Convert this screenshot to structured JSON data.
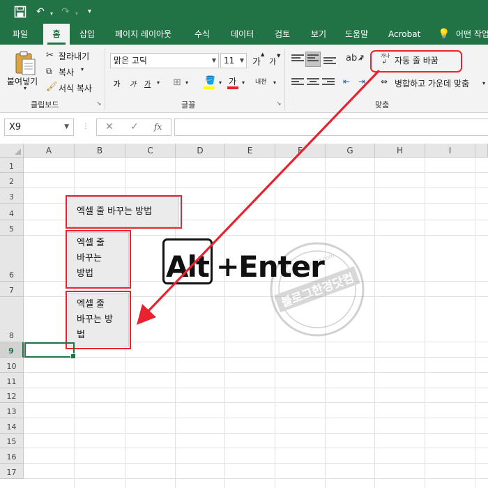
{
  "quick_access": {
    "save_icon": "save-icon",
    "undo_icon": "undo-icon",
    "redo_icon": "redo-icon"
  },
  "tabs": [
    {
      "label": "파일",
      "active": false
    },
    {
      "label": "홈",
      "active": true
    },
    {
      "label": "삽입",
      "active": false
    },
    {
      "label": "페이지 레이아웃",
      "active": false
    },
    {
      "label": "수식",
      "active": false
    },
    {
      "label": "데이터",
      "active": false
    },
    {
      "label": "검토",
      "active": false
    },
    {
      "label": "보기",
      "active": false
    },
    {
      "label": "도움말",
      "active": false
    },
    {
      "label": "Acrobat",
      "active": false
    },
    {
      "label": "어떤 작업",
      "active": false
    }
  ],
  "clipboard": {
    "paste": "붙여넣기",
    "cut": "잘라내기",
    "copy": "복사",
    "format_painter": "서식 복사",
    "group_label": "클립보드"
  },
  "font": {
    "name": "맑은 고딕",
    "size": "11",
    "increase": "가",
    "decrease": "가",
    "bold": "가",
    "italic": "가",
    "underline": "가",
    "font_color": "가",
    "phonetic": "내천",
    "group_label": "글꼴"
  },
  "alignment": {
    "wrap_text": "자동 줄 바꿈",
    "wrap_icon_text": "가나",
    "merge_center": "병합하고 가운데 맞춤",
    "group_label": "맞춤"
  },
  "formula_bar": {
    "name_box": "X9",
    "cancel": "✕",
    "enter": "✓",
    "fx": "fx",
    "formula": ""
  },
  "columns": [
    "A",
    "B",
    "C",
    "D",
    "E",
    "F",
    "G",
    "H",
    "I"
  ],
  "rows": [
    "1",
    "2",
    "3",
    "4",
    "5",
    "6",
    "7",
    "8",
    "9",
    "10",
    "11",
    "12",
    "13",
    "14",
    "15",
    "16",
    "17"
  ],
  "selected_row": "9",
  "cells": {
    "b4": "엑셀 줄 바꾸는 방법",
    "b6_line1": "엑셀 줄",
    "b6_line2": "바꾸는",
    "b6_line3": "방법",
    "b8_line1": "엑셀 줄",
    "b8_line2": "바꾸는 방",
    "b8_line3": "법"
  },
  "overlay": {
    "key": "Alt",
    "plus": "+",
    "enter": "Enter"
  },
  "watermark": {
    "main": "블로그한경닷컴",
    "url": "blog.hankyung.com"
  },
  "colors": {
    "excel_green": "#217346",
    "highlight_red": "#e8232f"
  }
}
